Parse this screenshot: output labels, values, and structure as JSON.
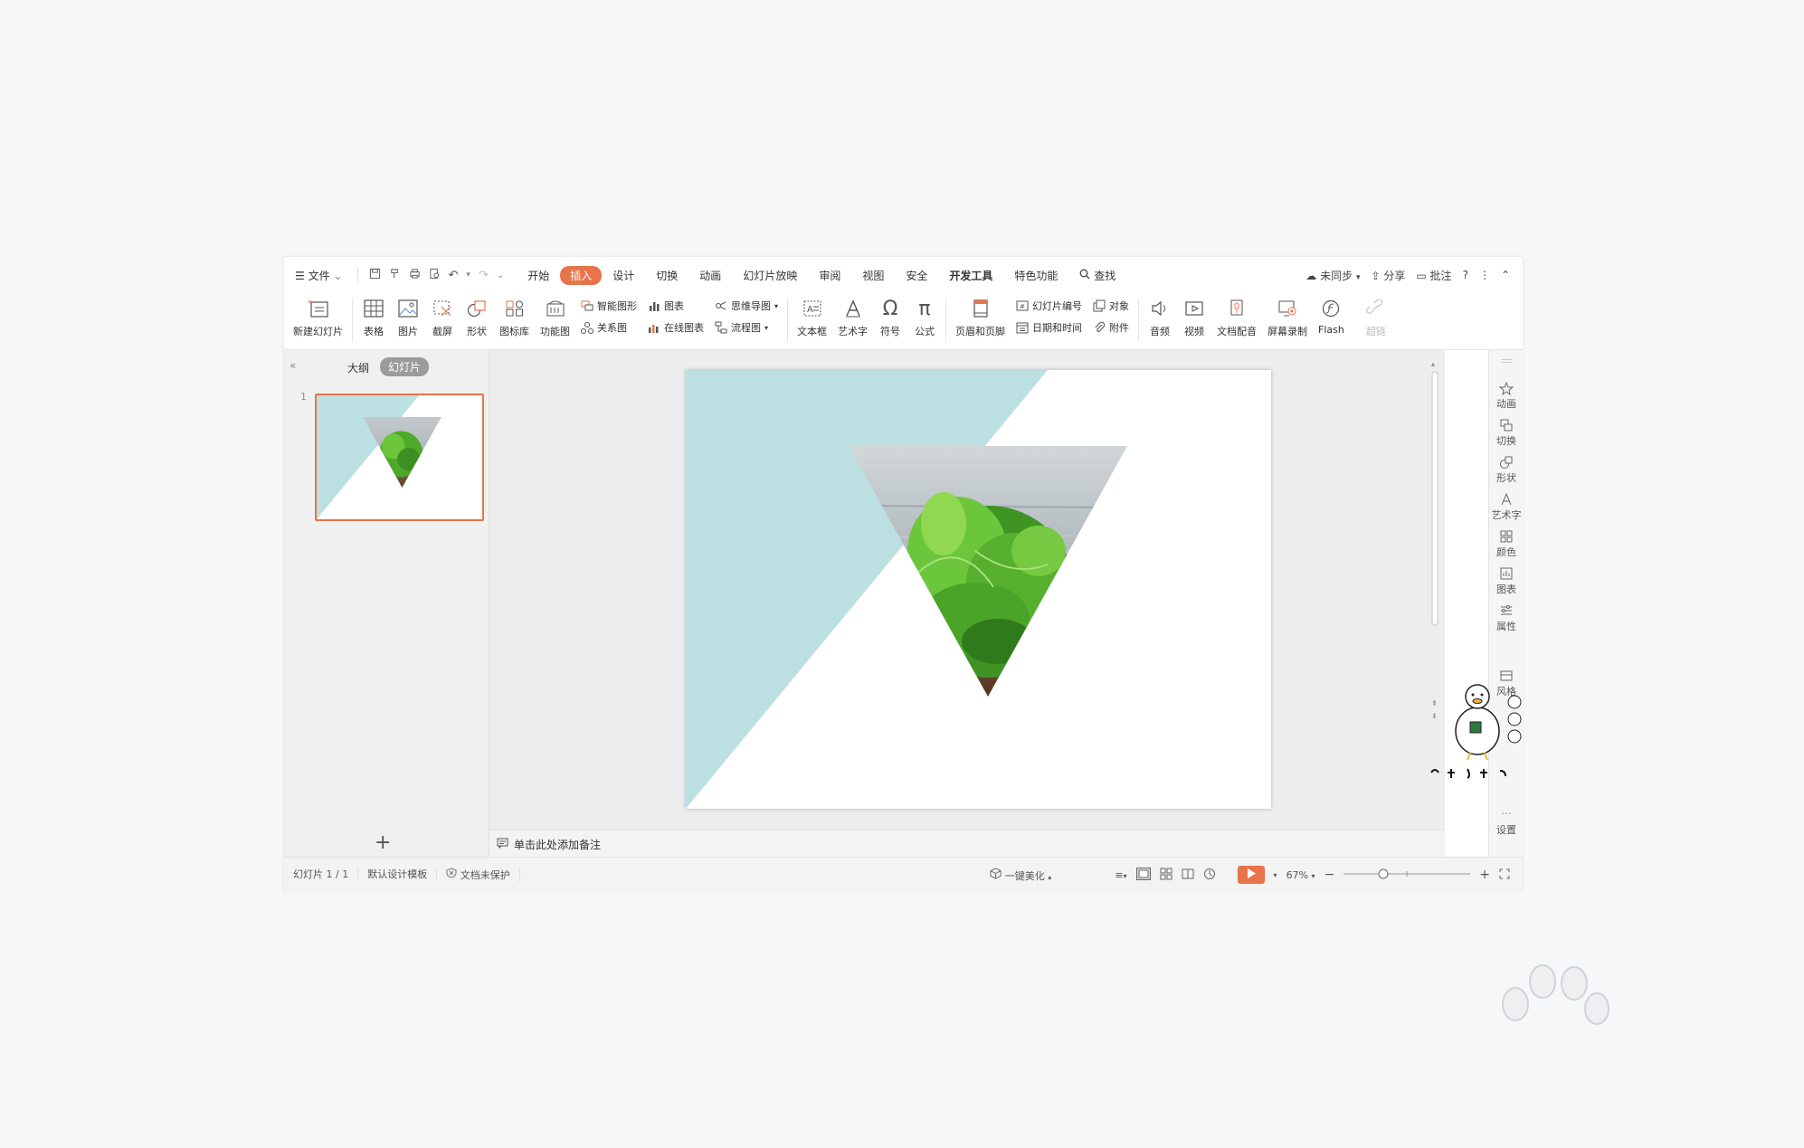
{
  "menubar": {
    "file_menu": "文件",
    "tabs": [
      "开始",
      "插入",
      "设计",
      "切换",
      "动画",
      "幻灯片放映",
      "审阅",
      "视图",
      "安全",
      "开发工具",
      "特色功能"
    ],
    "active_tab": "插入",
    "search": "查找",
    "sync": "未同步",
    "share": "分享",
    "review": "批注",
    "help": "?"
  },
  "ribbon": {
    "new_slide": "新建幻灯片",
    "table": "表格",
    "picture": "图片",
    "screenshot": "截屏",
    "shape": "形状",
    "icon_lib": "图标库",
    "func_chart": "功能图",
    "smart_art": "智能图形",
    "chart": "图表",
    "relation": "关系图",
    "online_chart": "在线图表",
    "mind_map": "思维导图",
    "flowchart": "流程图",
    "textbox": "文本框",
    "wordart": "艺术字",
    "symbol": "符号",
    "formula": "公式",
    "header_footer": "页眉和页脚",
    "slide_number": "幻灯片编号",
    "object": "对象",
    "date_time": "日期和时间",
    "attachment": "附件",
    "audio": "音频",
    "video": "视频",
    "dubbing": "文档配音",
    "screen_record": "屏幕录制",
    "flash": "Flash",
    "hyperlink": "超链"
  },
  "leftpanel": {
    "tab_outline": "大纲",
    "tab_slides": "幻灯片",
    "slide_number": "1",
    "add": "+"
  },
  "notes": {
    "placeholder": "单击此处添加备注"
  },
  "rightbar": [
    "动画",
    "切换",
    "形状",
    "艺术字",
    "颜色",
    "图表",
    "属性",
    "风格",
    "设置"
  ],
  "statusbar": {
    "slide_count": "幻灯片 1 / 1",
    "template": "默认设计模板",
    "protection": "文档未保护",
    "beautify": "一键美化",
    "zoom": "67%"
  },
  "colors": {
    "accent": "#e9734a",
    "slide_triangle": "#bcdfe2",
    "leaf_green": "#5cb82e"
  }
}
